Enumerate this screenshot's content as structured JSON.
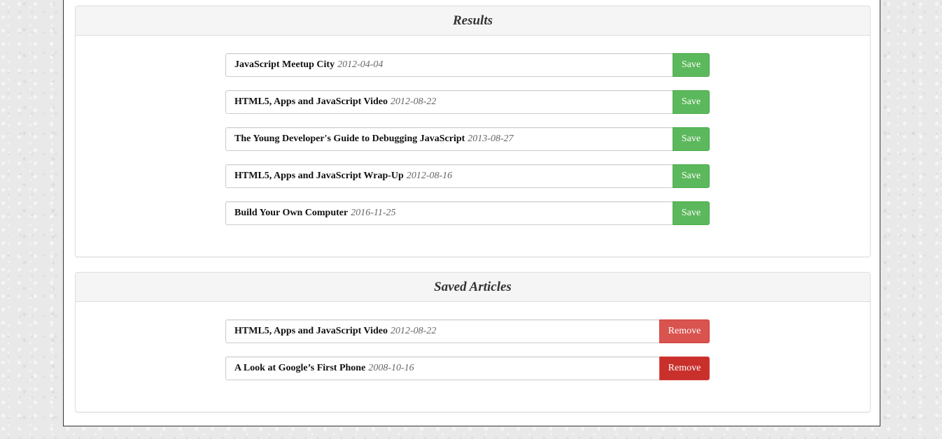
{
  "results": {
    "title": "Results",
    "articles": [
      {
        "title": "JavaScript Meetup City",
        "date": "2012-04-04",
        "action": "Save"
      },
      {
        "title": "HTML5, Apps and JavaScript Video",
        "date": "2012-08-22",
        "action": "Save"
      },
      {
        "title": "The Young Developer's Guide to Debugging JavaScript",
        "date": "2013-08-27",
        "action": "Save"
      },
      {
        "title": "HTML5, Apps and JavaScript Wrap-Up",
        "date": "2012-08-16",
        "action": "Save"
      },
      {
        "title": "Build Your Own Computer",
        "date": "2016-11-25",
        "action": "Save"
      }
    ]
  },
  "saved": {
    "title": "Saved Articles",
    "articles": [
      {
        "title": "HTML5, Apps and JavaScript Video",
        "date": "2012-08-22",
        "action": "Remove",
        "button_color": "#d9534f"
      },
      {
        "title": "A Look at Google’s First Phone",
        "date": "2008-10-16",
        "action": "Remove",
        "button_color": "#c9302c"
      }
    ]
  },
  "colors": {
    "save_button": "#5cb85c",
    "remove_button": "#d9534f",
    "remove_button_hover": "#c9302c"
  }
}
